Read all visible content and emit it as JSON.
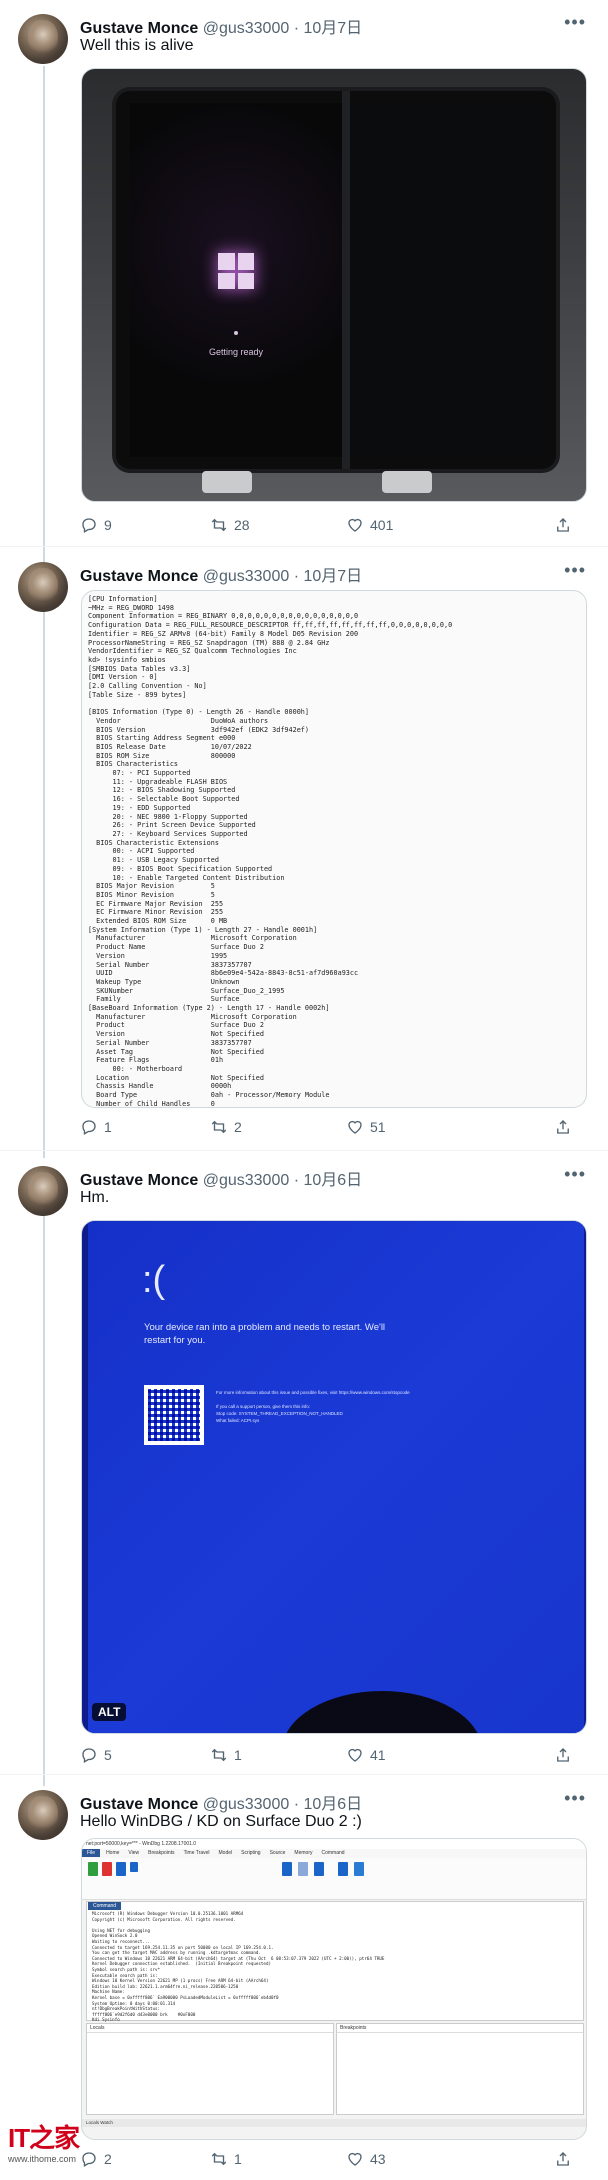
{
  "tweets": [
    {
      "name": "Gustave Monce",
      "handle": "@gus33000",
      "dot": "·",
      "date": "10月7日",
      "text": "Well this is alive",
      "replies": "9",
      "retweets": "28",
      "likes": "401",
      "media": {
        "status_text": "Getting ready"
      }
    },
    {
      "name": "Gustave Monce",
      "handle": "@gus33000",
      "dot": "·",
      "date": "10月7日",
      "text": "",
      "replies": "1",
      "retweets": "2",
      "likes": "51",
      "media": {
        "lines": [
          "[CPU Information]",
          "~MHz = REG_DWORD 1498",
          "Component Information = REG_BINARY 0,0,0,0,0,0,0,0,0,0,0,0,0,0,0,0",
          "Configuration Data = REG_FULL_RESOURCE_DESCRIPTOR ff,ff,ff,ff,ff,ff,ff,ff,0,0,0,0,0,0,0,0",
          "Identifier = REG_SZ ARMv8 (64-bit) Family 8 Model D05 Revision 200",
          "ProcessorNameString = REG_SZ Snapdragon (TM) 888 @ 2.84 GHz",
          "VendorIdentifier = REG_SZ Qualcomm Technologies Inc",
          "kd> !sysinfo smbios",
          "[SMBIOS Data Tables v3.3]",
          "[DMI Version - 0]",
          "[2.0 Calling Convention - No]",
          "[Table Size - 899 bytes]",
          "",
          "[BIOS Information (Type 0) - Length 26 - Handle 0000h]",
          "  Vendor                      DuoWoA authors",
          "  BIOS Version                3df942ef (EDK2 3df942ef)",
          "  BIOS Starting Address Segment e000",
          "  BIOS Release Date           10/07/2022",
          "  BIOS ROM Size               800000",
          "  BIOS Characteristics",
          "      07: - PCI Supported",
          "      11: - Upgradeable FLASH BIOS",
          "      12: - BIOS Shadowing Supported",
          "      16: - Selectable Boot Supported",
          "      19: - EDD Supported",
          "      20: - NEC 9800 1-Floppy Supported",
          "      26: - Print Screen Device Supported",
          "      27: - Keyboard Services Supported",
          "  BIOS Characteristic Extensions",
          "      00: - ACPI Supported",
          "      01: - USB Legacy Supported",
          "      09: - BIOS Boot Specification Supported",
          "      10: - Enable Targeted Content Distribution",
          "  BIOS Major Revision         5",
          "  BIOS Minor Revision         5",
          "  EC Firmware Major Revision  255",
          "  EC Firmware Minor Revision  255",
          "  Extended BIOS ROM Size      0 MB",
          "[System Information (Type 1) - Length 27 - Handle 0001h]",
          "  Manufacturer                Microsoft Corporation",
          "  Product Name                Surface Duo 2",
          "  Version                     1995",
          "  Serial Number               3837357707",
          "  UUID                        8b6e09e4-542a-8843-8c51-af7d960a93cc",
          "  Wakeup Type                 Unknown",
          "  SKUNumber                   Surface_Duo_2_1995",
          "  Family                      Surface",
          "[BaseBoard Information (Type 2) - Length 17 - Handle 0002h]",
          "  Manufacturer                Microsoft Corporation",
          "  Product                     Surface Duo 2",
          "  Version                     Not Specified",
          "  Serial Number               3837357707",
          "  Asset Tag                   Not Specified",
          "  Feature Flags               01h",
          "      00: - Motherboard",
          "  Location                    Not Specified",
          "  Chassis Handle              0000h",
          "  Board Type                  0ah - Processor/Memory Module",
          "  Number of Child Handles     0"
        ]
      }
    },
    {
      "name": "Gustave Monce",
      "handle": "@gus33000",
      "dot": "·",
      "date": "10月6日",
      "text": "Hm.",
      "replies": "5",
      "retweets": "1",
      "likes": "41",
      "media": {
        "sad_face": ":(",
        "message": "Your device ran into a problem and needs to restart. We'll restart for you.",
        "info": "For more information about this issue and possible fixes, visit https://www.windows.com/stopcode\n\nIf you call a support person, give them this info:\nStop code: SYSTEM_THREAD_EXCEPTION_NOT_HANDLED\nWhat failed: ACPI.sys",
        "alt_badge": "ALT"
      }
    },
    {
      "name": "Gustave Monce",
      "handle": "@gus33000",
      "dot": "·",
      "date": "10月6日",
      "text": "Hello WinDBG / KD on Surface Duo 2 :)",
      "replies": "2",
      "retweets": "1",
      "likes": "43",
      "media": {
        "title": "net:port=50000,key=*** - WinDbg 1.2208.17001.0",
        "menu": [
          "File",
          "Home",
          "View",
          "Breakpoints",
          "Time Travel",
          "Model",
          "Scripting",
          "Source",
          "Memory",
          "Command"
        ],
        "command_tab": "Command",
        "output": "Microsoft (R) Windows Debugger Version 10.0.25136.1001 ARM64\nCopyright (c) Microsoft Corporation. All rights reserved.\n\nUsing NET for debugging\nOpened WinSock 2.0\nWaiting to reconnect...\nConnected to target 169.254.11.35 on port 50000 on local IP 169.254.0.1.\nYou can get the target MAC address by running .kdtargetmac command.\nConnected to Windows 10 22621 ARM 64-bit (AArch64) target at (Thu Oct  6 08:53:07.379 2022 (UTC + 2:00)), ptr64 TRUE\nKernel Debugger connection established.  (Initial Breakpoint requested)\nSymbol search path is: srv*\nExecutable search path is:\nWindows 10 Kernel Version 22621 MP (1 procs) Free ARM 64-bit (AArch64)\nEdition build lab: 22621.1.arm64fre.ni_release.220506-1250\nMachine Name:\nKernel base = 0xfffff806` Ea900000 PsLoadedModuleList = 0xfffff806`eb4d0f0\nSystem Uptime: 0 days 0:00:01.314\nnt!DbgBreakPointWithStatus:\nfffff806`e9d2f6d0 d43e0000 brk    #0xF000\nKdi Sysinfo",
        "panels": [
          "Locals",
          "Breakpoints"
        ],
        "status": "Locals  Watch"
      }
    }
  ],
  "watermark": {
    "brand": "IT之家",
    "site": "www.ithome.com"
  }
}
